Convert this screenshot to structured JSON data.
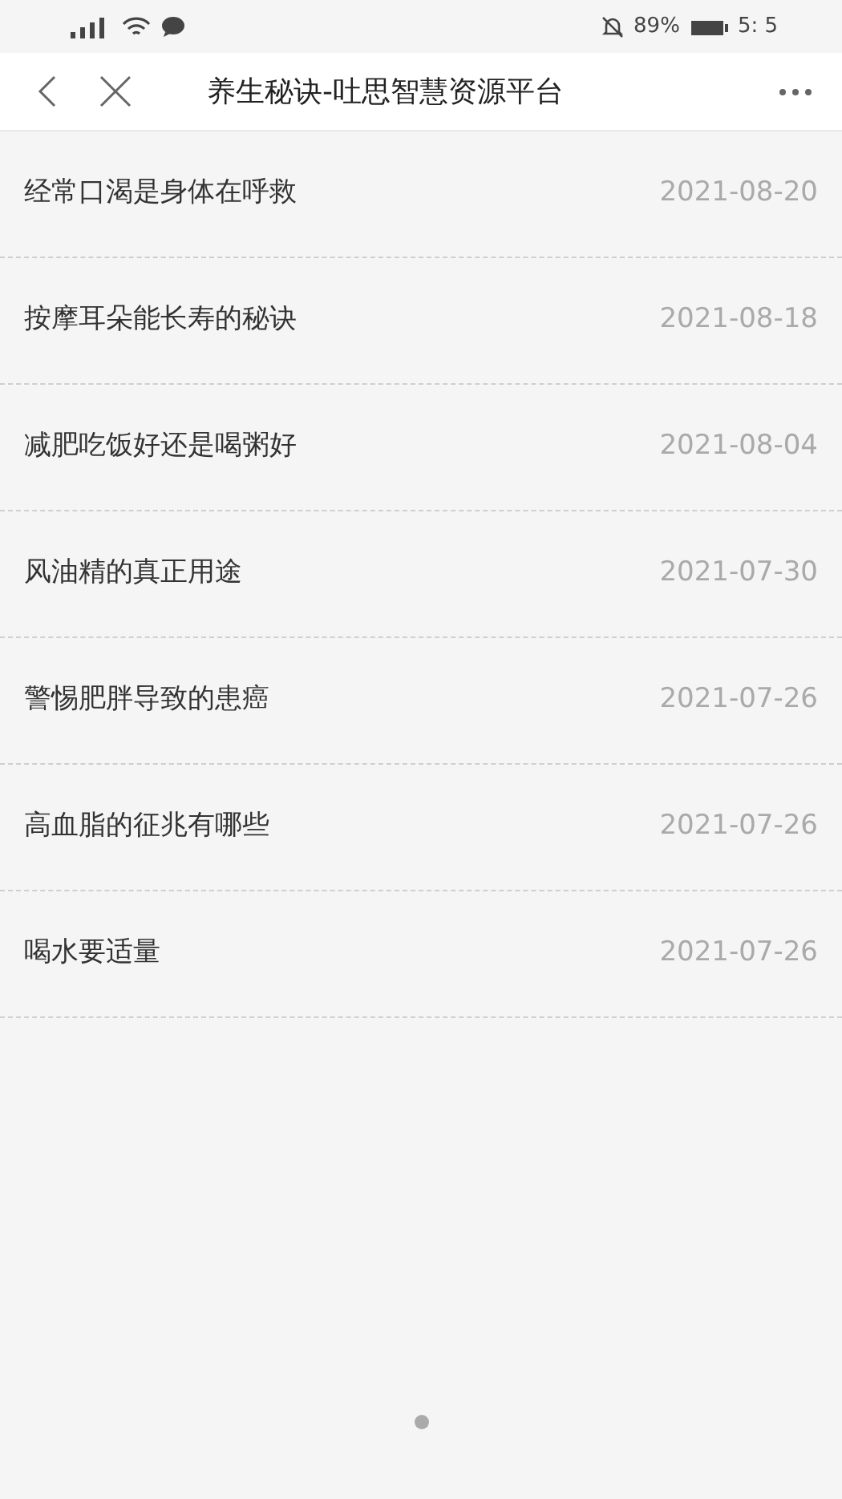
{
  "status_bar": {
    "battery_text": "89%",
    "time": "5: 5"
  },
  "header": {
    "title": "养生秘诀-吐思智慧资源平台"
  },
  "articles": [
    {
      "title": "经常口渴是身体在呼救",
      "date": "2021-08-20"
    },
    {
      "title": "按摩耳朵能长寿的秘诀",
      "date": "2021-08-18"
    },
    {
      "title": "减肥吃饭好还是喝粥好",
      "date": "2021-08-04"
    },
    {
      "title": "风油精的真正用途",
      "date": "2021-07-30"
    },
    {
      "title": "警惕肥胖导致的患癌",
      "date": "2021-07-26"
    },
    {
      "title": "高血脂的征兆有哪些",
      "date": "2021-07-26"
    },
    {
      "title": "喝水要适量",
      "date": "2021-07-26"
    }
  ]
}
